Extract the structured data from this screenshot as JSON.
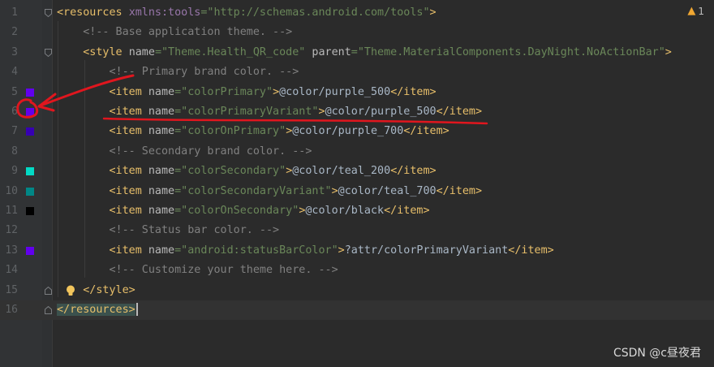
{
  "editor": {
    "warning": {
      "icon": "warning-triangle-icon",
      "count": "1"
    },
    "watermark": "CSDN @c昼夜君",
    "annotation_color": "#e0161e",
    "lines": [
      {
        "num": "1",
        "parts": [
          [
            "tag",
            "<resources"
          ],
          [
            "txt",
            " "
          ],
          [
            "ns",
            "xmlns:tools"
          ],
          [
            "val",
            "=\"http://schemas.android.com/tools\""
          ],
          [
            "tag",
            ">"
          ]
        ]
      },
      {
        "num": "2",
        "parts": [
          [
            "txt",
            "    "
          ],
          [
            "com",
            "<!-- Base application theme. -->"
          ]
        ]
      },
      {
        "num": "3",
        "parts": [
          [
            "txt",
            "    "
          ],
          [
            "tag",
            "<style "
          ],
          [
            "attr",
            "name"
          ],
          [
            "val",
            "=\"Theme.Health_QR_code\" "
          ],
          [
            "attr",
            "parent"
          ],
          [
            "val",
            "=\"Theme.MaterialComponents.DayNight.NoActionBar\""
          ],
          [
            "tag",
            ">"
          ]
        ]
      },
      {
        "num": "4",
        "parts": [
          [
            "txt",
            "        "
          ],
          [
            "com",
            "<!-- Primary brand color. -->"
          ]
        ]
      },
      {
        "num": "5",
        "parts": [
          [
            "txt",
            "        "
          ],
          [
            "tag",
            "<item "
          ],
          [
            "attr",
            "name"
          ],
          [
            "val",
            "=\"colorPrimary\""
          ],
          [
            "tag",
            ">"
          ],
          [
            "txt",
            "@color/purple_500"
          ],
          [
            "tag",
            "</item>"
          ]
        ]
      },
      {
        "num": "6",
        "parts": [
          [
            "txt",
            "        "
          ],
          [
            "tag",
            "<item "
          ],
          [
            "attr",
            "name"
          ],
          [
            "val",
            "=\"colorPrimaryVariant\""
          ],
          [
            "tag",
            ">"
          ],
          [
            "txt",
            "@color/purple_500"
          ],
          [
            "tag",
            "</item>"
          ]
        ]
      },
      {
        "num": "7",
        "parts": [
          [
            "txt",
            "        "
          ],
          [
            "tag",
            "<item "
          ],
          [
            "attr",
            "name"
          ],
          [
            "val",
            "=\"colorOnPrimary\""
          ],
          [
            "tag",
            ">"
          ],
          [
            "txt",
            "@color/purple_700"
          ],
          [
            "tag",
            "</item>"
          ]
        ]
      },
      {
        "num": "8",
        "parts": [
          [
            "txt",
            "        "
          ],
          [
            "com",
            "<!-- Secondary brand color. -->"
          ]
        ]
      },
      {
        "num": "9",
        "parts": [
          [
            "txt",
            "        "
          ],
          [
            "tag",
            "<item "
          ],
          [
            "attr",
            "name"
          ],
          [
            "val",
            "=\"colorSecondary\""
          ],
          [
            "tag",
            ">"
          ],
          [
            "txt",
            "@color/teal_200"
          ],
          [
            "tag",
            "</item>"
          ]
        ]
      },
      {
        "num": "10",
        "parts": [
          [
            "txt",
            "        "
          ],
          [
            "tag",
            "<item "
          ],
          [
            "attr",
            "name"
          ],
          [
            "val",
            "=\"colorSecondaryVariant\""
          ],
          [
            "tag",
            ">"
          ],
          [
            "txt",
            "@color/teal_700"
          ],
          [
            "tag",
            "</item>"
          ]
        ]
      },
      {
        "num": "11",
        "parts": [
          [
            "txt",
            "        "
          ],
          [
            "tag",
            "<item "
          ],
          [
            "attr",
            "name"
          ],
          [
            "val",
            "=\"colorOnSecondary\""
          ],
          [
            "tag",
            ">"
          ],
          [
            "txt",
            "@color/black"
          ],
          [
            "tag",
            "</item>"
          ]
        ]
      },
      {
        "num": "12",
        "parts": [
          [
            "txt",
            "        "
          ],
          [
            "com",
            "<!-- Status bar color. -->"
          ]
        ]
      },
      {
        "num": "13",
        "parts": [
          [
            "txt",
            "        "
          ],
          [
            "tag",
            "<item "
          ],
          [
            "attr",
            "name"
          ],
          [
            "val",
            "=\"android:statusBarColor\""
          ],
          [
            "tag",
            ">"
          ],
          [
            "txt",
            "?attr/colorPrimaryVariant"
          ],
          [
            "tag",
            "</item>"
          ]
        ]
      },
      {
        "num": "14",
        "parts": [
          [
            "txt",
            "        "
          ],
          [
            "com",
            "<!-- Customize your theme here. -->"
          ]
        ]
      },
      {
        "num": "15",
        "parts": [
          [
            "txt",
            "    "
          ],
          [
            "tag",
            "</style>"
          ]
        ]
      },
      {
        "num": "16",
        "parts": [
          [
            "tagres",
            "</resources>"
          ]
        ]
      }
    ],
    "swatches": [
      {
        "line": 5,
        "color": "#6200ee"
      },
      {
        "line": 6,
        "color": "#6200ee"
      },
      {
        "line": 7,
        "color": "#3700b3"
      },
      {
        "line": 9,
        "color": "#03dac5"
      },
      {
        "line": 10,
        "color": "#018786"
      },
      {
        "line": 11,
        "color": "#000000"
      },
      {
        "line": 13,
        "color": "#6200ee"
      }
    ],
    "fold_markers": [
      1,
      3,
      15,
      16
    ],
    "bulb_line": 15,
    "current_line": 16
  }
}
